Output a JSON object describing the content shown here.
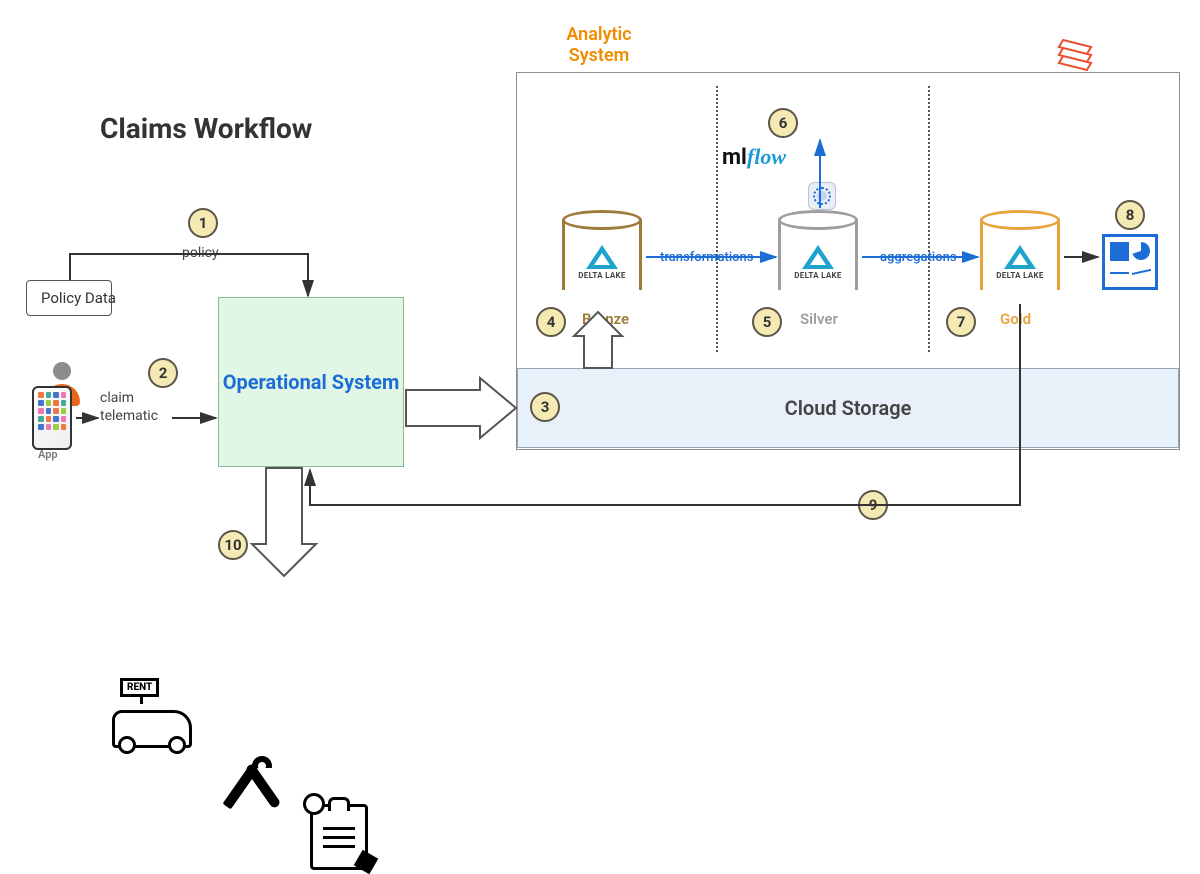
{
  "title": "Claims Workflow",
  "analytic_system_label": "Analytic System",
  "policy_data_label": "Policy Data",
  "operational_system_label": "Operational System",
  "cloud_storage_label": "Cloud Storage",
  "policy_arrow_label": "policy",
  "claim_label": "claim",
  "telematic_label": "telematic",
  "app_label": "App",
  "rent_label": "RENT",
  "mlflow_ml": "ml",
  "mlflow_flow": "flow",
  "tiers": {
    "bronze": {
      "name": "Bronze",
      "delta": "DELTA LAKE"
    },
    "silver": {
      "name": "Silver",
      "delta": "DELTA LAKE"
    },
    "gold": {
      "name": "Gold",
      "delta": "DELTA LAKE"
    }
  },
  "flows": {
    "transformations": "transformations",
    "aggregations": "aggregations"
  },
  "steps": {
    "s1": "1",
    "s2": "2",
    "s3": "3",
    "s4": "4",
    "s5": "5",
    "s6": "6",
    "s7": "7",
    "s8": "8",
    "s9": "9",
    "s10": "10"
  }
}
